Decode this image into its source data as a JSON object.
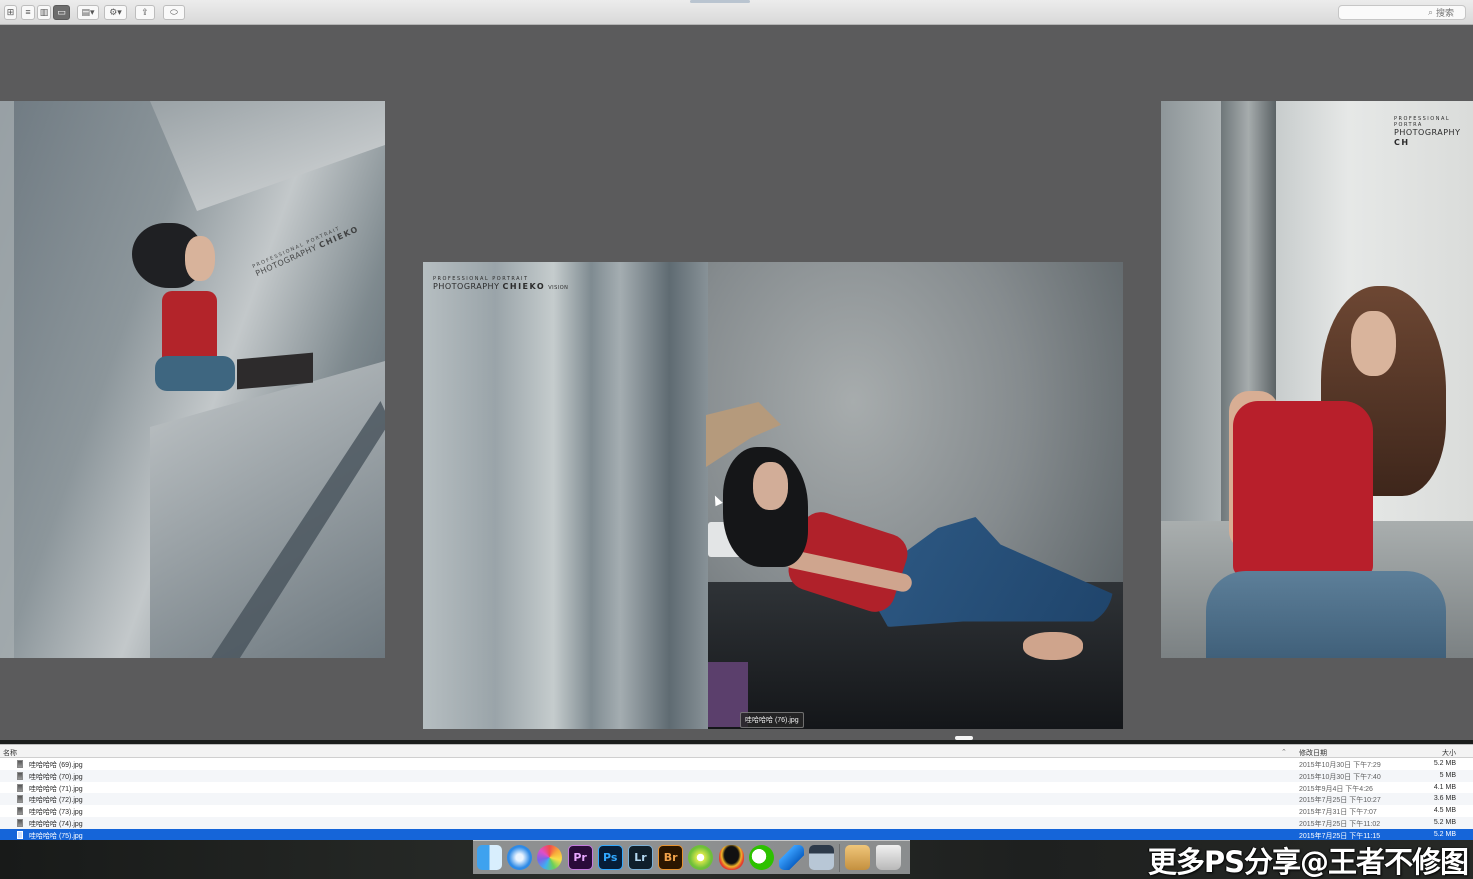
{
  "toolbar": {
    "view_icons": [
      "icon-view-icon",
      "list-view-icon",
      "column-view-icon",
      "cover-flow-view-icon"
    ],
    "arrange_icon": "arrange-icon",
    "action_icon": "gear-icon",
    "share_icon": "share-icon",
    "tag_icon": "tag-icon",
    "search_placeholder": "搜索"
  },
  "coverflow": {
    "watermark_line1": "PROFESSIONAL PORTRAIT",
    "watermark_prefix": "PHOTOGRAPHY",
    "watermark_brand": "CHIEKO",
    "watermark_suffix": "VISION",
    "watermark_right_line1": "PROFESSIONAL PORTRA",
    "watermark_right_prefix": "PHOTOGRAPHY",
    "watermark_right_brand": "CH",
    "tooltip": "哇哈哈哈 (76).jpg"
  },
  "list": {
    "headers": {
      "name": "名称",
      "date": "修改日期",
      "size": "大小"
    },
    "rows": [
      {
        "name": "哇哈哈哈 (69).jpg",
        "date": "2015年10月30日 下午7:29",
        "size": "5.2 MB"
      },
      {
        "name": "哇哈哈哈 (70).jpg",
        "date": "2015年10月30日 下午7:40",
        "size": "5 MB"
      },
      {
        "name": "哇哈哈哈 (71).jpg",
        "date": "2015年9月4日 下午4:26",
        "size": "4.1 MB"
      },
      {
        "name": "哇哈哈哈 (72).jpg",
        "date": "2015年7月25日 下午10:27",
        "size": "3.6 MB"
      },
      {
        "name": "哇哈哈哈 (73).jpg",
        "date": "2015年7月31日 下午7:07",
        "size": "4.5 MB"
      },
      {
        "name": "哇哈哈哈 (74).jpg",
        "date": "2015年7月25日 下午11:02",
        "size": "5.2 MB"
      },
      {
        "name": "哇哈哈哈 (75).jpg",
        "date": "2015年7月25日 下午11:15",
        "size": "5.2 MB"
      }
    ],
    "selected_index": 6,
    "selection_color": "#1565d9"
  },
  "dock": {
    "pr_label": "Pr",
    "ps_label": "Ps",
    "lr_label": "Lr",
    "br_label": "Br"
  },
  "overlay": {
    "brand_text": "更多PS分享@王者不修图"
  }
}
